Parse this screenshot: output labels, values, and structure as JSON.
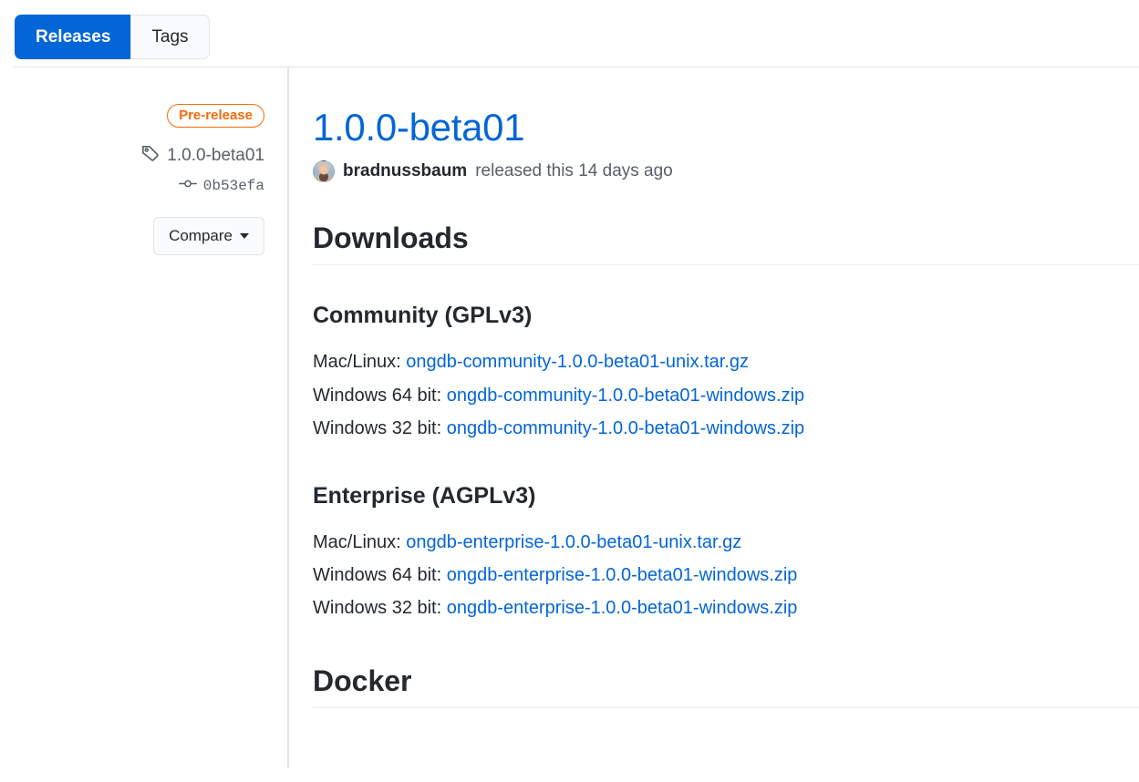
{
  "toggle": {
    "releases_label": "Releases",
    "tags_label": "Tags"
  },
  "sidebar": {
    "prerelease_label": "Pre-release",
    "tag_name": "1.0.0-beta01",
    "commit_sha": "0b53efa",
    "compare_label": "Compare"
  },
  "release": {
    "title": "1.0.0-beta01",
    "author": "bradnussbaum",
    "released_text": "released this 14 days ago"
  },
  "downloads": {
    "heading": "Downloads",
    "sections": [
      {
        "heading": "Community (GPLv3)",
        "rows": [
          {
            "label": "Mac/Linux:",
            "link": "ongdb-community-1.0.0-beta01-unix.tar.gz"
          },
          {
            "label": "Windows 64 bit:",
            "link": "ongdb-community-1.0.0-beta01-windows.zip"
          },
          {
            "label": "Windows 32 bit:",
            "link": "ongdb-community-1.0.0-beta01-windows.zip"
          }
        ]
      },
      {
        "heading": "Enterprise (AGPLv3)",
        "rows": [
          {
            "label": "Mac/Linux:",
            "link": "ongdb-enterprise-1.0.0-beta01-unix.tar.gz"
          },
          {
            "label": "Windows 64 bit:",
            "link": "ongdb-enterprise-1.0.0-beta01-windows.zip"
          },
          {
            "label": "Windows 32 bit:",
            "link": "ongdb-enterprise-1.0.0-beta01-windows.zip"
          }
        ]
      }
    ]
  },
  "docker": {
    "heading": "Docker"
  },
  "colors": {
    "accent_blue": "#0366d6",
    "prerelease_orange": "#f66a0a",
    "muted_gray": "#586069",
    "border_gray": "#e1e4e8"
  }
}
